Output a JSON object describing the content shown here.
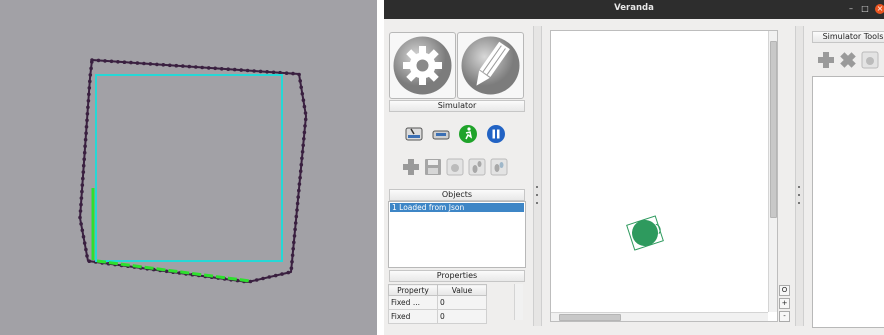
{
  "window": {
    "title": "Veranda",
    "minimize_glyph": "–",
    "maximize_glyph": "□",
    "close_glyph": "×"
  },
  "left_panel": {
    "background": "#a2a1a6",
    "outer_path_color": "#3a2040",
    "inner_square_color": "#25d8d6",
    "trace_color": "#2ee02e"
  },
  "simulator": {
    "settings_icon": "gear-icon",
    "designer_icon": "pencil-icon",
    "section_label": "Simulator",
    "toolbar_row1": [
      "joystick-icon",
      "controller-icon",
      "run-icon",
      "pause-icon"
    ],
    "toolbar_row2": [
      "add-icon",
      "save-icon",
      "disk-icon",
      "footprint-icon",
      "footprint-alt-icon"
    ]
  },
  "objects": {
    "section_label": "Objects",
    "items": [
      "1 Loaded from Json"
    ]
  },
  "properties": {
    "section_label": "Properties",
    "columns": [
      "Property",
      "Value"
    ],
    "rows": [
      {
        "property": "Fixed ...",
        "value": "0"
      },
      {
        "property": "Fixed",
        "value": "0"
      }
    ]
  },
  "canvas": {
    "robot_color": "#2e9a5e",
    "zoom_buttons": [
      "O",
      "+",
      "-"
    ]
  },
  "simulator_tools": {
    "section_label": "Simulator Tools",
    "icons": [
      "add-icon",
      "remove-icon",
      "disk-icon"
    ]
  }
}
